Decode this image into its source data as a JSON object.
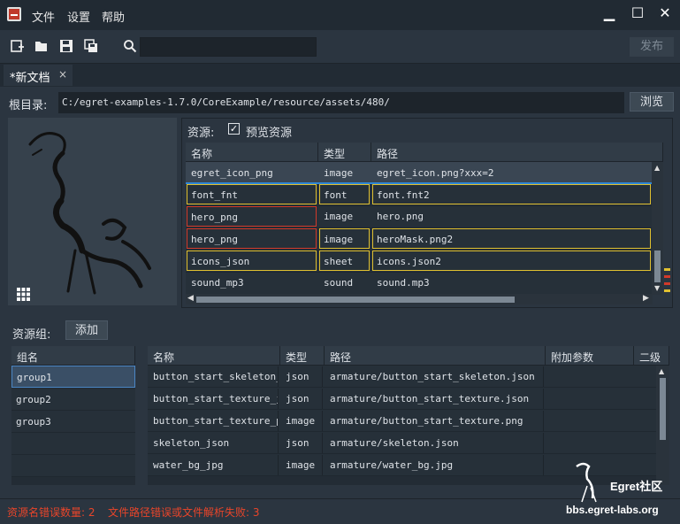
{
  "titlebar": {
    "menus": [
      "文件",
      "设置",
      "帮助"
    ]
  },
  "toolbar": {
    "search_value": "",
    "publish_label": "发布"
  },
  "tab": {
    "label": "*新文档",
    "close": "×"
  },
  "rootdir": {
    "label": "根目录:",
    "path": "C:/egret-examples-1.7.0/CoreExample/resource/assets/480/",
    "browse_label": "浏览"
  },
  "resources": {
    "label": "资源:",
    "preview_label": "预览资源",
    "preview_checked": true,
    "columns": [
      "名称",
      "类型",
      "路径"
    ],
    "rows": [
      {
        "name": "egret_icon_png",
        "type": "image",
        "path": "egret_icon.png?xxx=2"
      },
      {
        "name": "font_fnt",
        "type": "font",
        "path": "font.fnt2"
      },
      {
        "name": "hero_png",
        "type": "image",
        "path": "hero.png"
      },
      {
        "name": "hero_png",
        "type": "image",
        "path": "heroMask.png2"
      },
      {
        "name": "icons_json",
        "type": "sheet",
        "path": "icons.json2"
      },
      {
        "name": "sound_mp3",
        "type": "sound",
        "path": "sound.mp3"
      }
    ]
  },
  "groups": {
    "label": "资源组:",
    "add_label": "添加",
    "list_header": "组名",
    "items": [
      "group1",
      "group2",
      "group3"
    ]
  },
  "group_items": {
    "columns": [
      "名称",
      "类型",
      "路径",
      "附加参数",
      "二级"
    ],
    "rows": [
      {
        "name": "button_start_skeleton_js",
        "type": "json",
        "path": "armature/button_start_skeleton.json"
      },
      {
        "name": "button_start_texture_js",
        "type": "json",
        "path": "armature/button_start_texture.json"
      },
      {
        "name": "button_start_texture_png",
        "type": "image",
        "path": "armature/button_start_texture.png"
      },
      {
        "name": "skeleton_json",
        "type": "json",
        "path": "armature/skeleton.json"
      },
      {
        "name": "water_bg_jpg",
        "type": "image",
        "path": "armature/water_bg.jpg"
      }
    ]
  },
  "status": {
    "name_error_label": "资源名错误数量: 2",
    "path_error_label": "文件路径错误或文件解析失败: 3"
  },
  "watermark": {
    "brand": "Egret社区",
    "url": "bbs.egret-labs.org"
  }
}
